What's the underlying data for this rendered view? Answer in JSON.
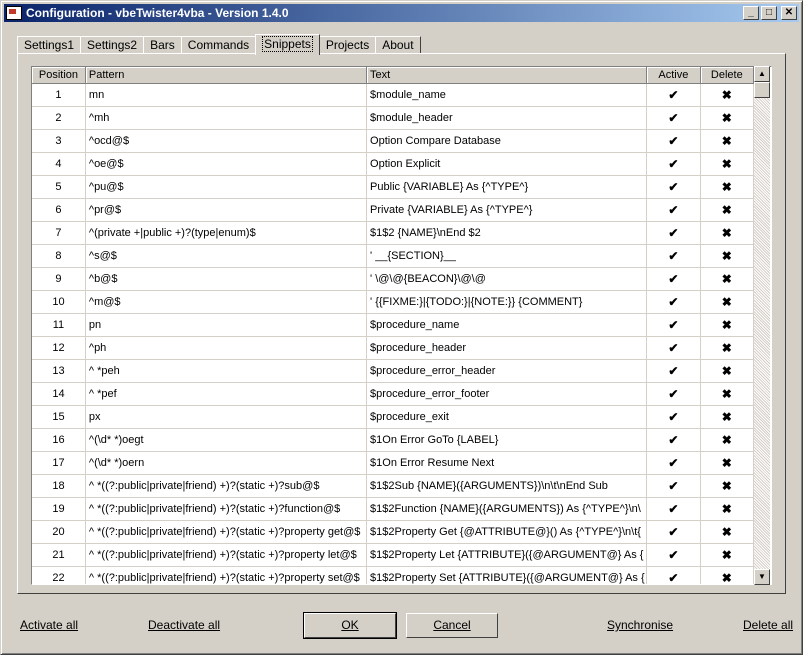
{
  "window": {
    "title": "Configuration - vbeTwister4vba - Version 1.4.0"
  },
  "tabs": [
    "Settings1",
    "Settings2",
    "Bars",
    "Commands",
    "Snippets",
    "Projects",
    "About"
  ],
  "active_tab": "Snippets",
  "columns": {
    "position": "Position",
    "pattern": "Pattern",
    "text": "Text",
    "active": "Active",
    "delete": "Delete"
  },
  "rows": [
    {
      "position": "1",
      "pattern": "mn",
      "text": "$module_name",
      "active": "✔",
      "delete": "✖"
    },
    {
      "position": "2",
      "pattern": "^mh",
      "text": "$module_header",
      "active": "✔",
      "delete": "✖"
    },
    {
      "position": "3",
      "pattern": "^ocd@$",
      "text": "Option Compare Database",
      "active": "✔",
      "delete": "✖"
    },
    {
      "position": "4",
      "pattern": "^oe@$",
      "text": "Option Explicit",
      "active": "✔",
      "delete": "✖"
    },
    {
      "position": "5",
      "pattern": "^pu@$",
      "text": "Public {VARIABLE} As {^TYPE^}",
      "active": "✔",
      "delete": "✖"
    },
    {
      "position": "6",
      "pattern": "^pr@$",
      "text": "Private {VARIABLE} As {^TYPE^}",
      "active": "✔",
      "delete": "✖"
    },
    {
      "position": "7",
      "pattern": "^(private +|public +)?(type|enum)$",
      "text": "$1$2 {NAME}\\nEnd $2",
      "active": "✔",
      "delete": "✖"
    },
    {
      "position": "8",
      "pattern": "^s@$",
      "text": "' __{SECTION}__",
      "active": "✔",
      "delete": "✖"
    },
    {
      "position": "9",
      "pattern": "^b@$",
      "text": "' \\@\\@{BEACON}\\@\\@",
      "active": "✔",
      "delete": "✖"
    },
    {
      "position": "10",
      "pattern": "^m@$",
      "text": "' {{FIXME:}|{TODO:}|{NOTE:}} {COMMENT}",
      "active": "✔",
      "delete": "✖"
    },
    {
      "position": "11",
      "pattern": "pn",
      "text": "$procedure_name",
      "active": "✔",
      "delete": "✖"
    },
    {
      "position": "12",
      "pattern": "^ph",
      "text": "$procedure_header",
      "active": "✔",
      "delete": "✖"
    },
    {
      "position": "13",
      "pattern": "^ *peh",
      "text": "$procedure_error_header",
      "active": "✔",
      "delete": "✖"
    },
    {
      "position": "14",
      "pattern": "^ *pef",
      "text": "$procedure_error_footer",
      "active": "✔",
      "delete": "✖"
    },
    {
      "position": "15",
      "pattern": "px",
      "text": "$procedure_exit",
      "active": "✔",
      "delete": "✖"
    },
    {
      "position": "16",
      "pattern": "^(\\d* *)oegt",
      "text": "$1On Error GoTo {LABEL}",
      "active": "✔",
      "delete": "✖"
    },
    {
      "position": "17",
      "pattern": "^(\\d* *)oern",
      "text": "$1On Error Resume Next",
      "active": "✔",
      "delete": "✖"
    },
    {
      "position": "18",
      "pattern": "^ *((?:public|private|friend) +)?(static +)?sub@$",
      "text": "$1$2Sub {NAME}({ARGUMENTS})\\n\\t\\nEnd Sub",
      "active": "✔",
      "delete": "✖"
    },
    {
      "position": "19",
      "pattern": "^ *((?:public|private|friend) +)?(static +)?function@$",
      "text": "$1$2Function {NAME}({ARGUMENTS}) As {^TYPE^}\\n\\",
      "active": "✔",
      "delete": "✖"
    },
    {
      "position": "20",
      "pattern": "^ *((?:public|private|friend) +)?(static +)?property get@$",
      "text": "$1$2Property Get {@ATTRIBUTE@}() As {^TYPE^}\\n\\t{",
      "active": "✔",
      "delete": "✖"
    },
    {
      "position": "21",
      "pattern": "^ *((?:public|private|friend) +)?(static +)?property let@$",
      "text": "$1$2Property Let {ATTRIBUTE}({@ARGUMENT@} As {",
      "active": "✔",
      "delete": "✖"
    },
    {
      "position": "22",
      "pattern": "^ *((?:public|private|friend) +)?(static +)?property set@$",
      "text": "$1$2Property Set {ATTRIBUTE}({@ARGUMENT@} As {",
      "active": "✔",
      "delete": "✖"
    }
  ],
  "footer": {
    "activate_all": "Activate all",
    "deactivate_all": "Deactivate all",
    "ok": "OK",
    "cancel": "Cancel",
    "synchronise": "Synchronise",
    "delete_all": "Delete all"
  },
  "colors": {
    "title_start": "#0a246a",
    "title_end": "#a6caf0",
    "face": "#d4d0c8"
  }
}
